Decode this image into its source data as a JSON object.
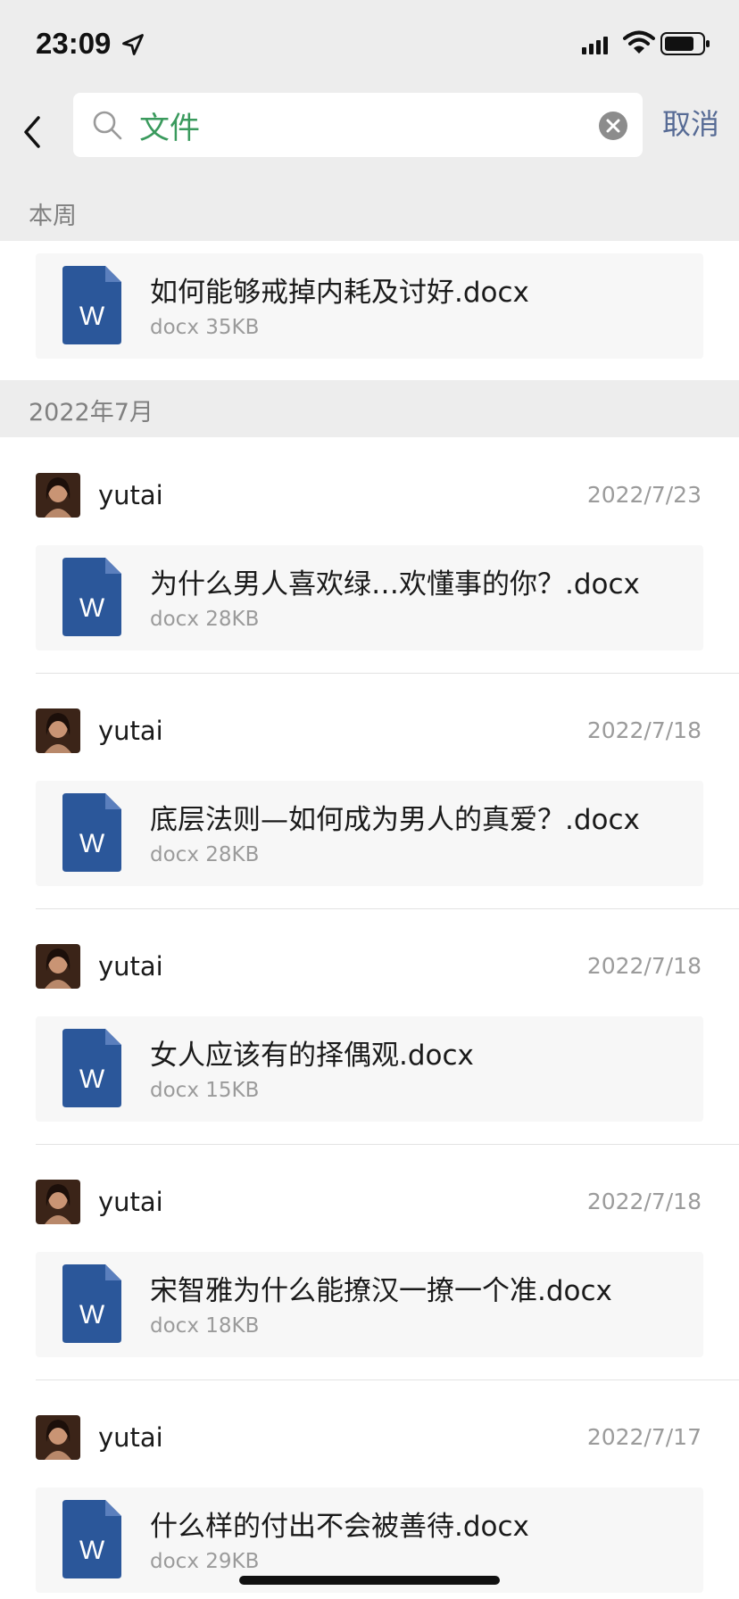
{
  "status": {
    "time": "23:09"
  },
  "search": {
    "query": "文件",
    "cancel_label": "取消"
  },
  "sections": {
    "this_week": "本周",
    "july_2022": "2022年7月"
  },
  "week_file": {
    "name": "如何能够戒掉内耗及讨好.docx",
    "meta": "docx 35KB",
    "icon_letter": "W"
  },
  "entries": [
    {
      "sender": "yutai",
      "date": "2022/7/23",
      "name": "为什么男人喜欢绿…欢懂事的你？.docx",
      "meta": "docx 28KB",
      "icon_letter": "W"
    },
    {
      "sender": "yutai",
      "date": "2022/7/18",
      "name": "底层法则—如何成为男人的真爱？.docx",
      "meta": "docx 28KB",
      "icon_letter": "W"
    },
    {
      "sender": "yutai",
      "date": "2022/7/18",
      "name": "女人应该有的择偶观.docx",
      "meta": "docx 15KB",
      "icon_letter": "W"
    },
    {
      "sender": "yutai",
      "date": "2022/7/18",
      "name": "宋智雅为什么能撩汉一撩一个准.docx",
      "meta": "docx 18KB",
      "icon_letter": "W"
    },
    {
      "sender": "yutai",
      "date": "2022/7/17",
      "name": "什么样的付出不会被善待.docx",
      "meta": "docx 29KB",
      "icon_letter": "W"
    }
  ],
  "colors": {
    "search_text": "#3a9a5d",
    "cancel": "#576b95",
    "word_blue": "#2b579a",
    "section_bg": "#ededed"
  }
}
